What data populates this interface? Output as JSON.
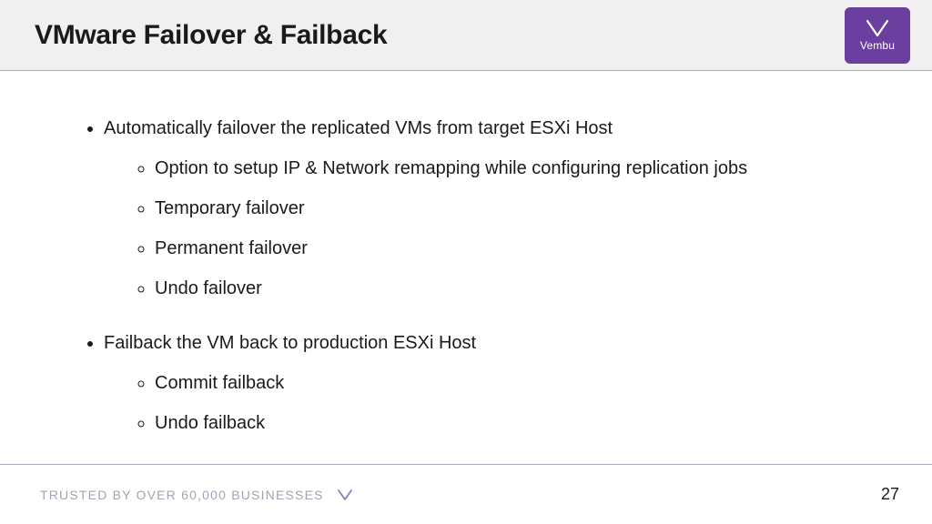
{
  "header": {
    "title": "VMware Failover & Failback",
    "brand_name": "Vembu"
  },
  "content": {
    "bullets": [
      {
        "text": "Automatically failover the replicated VMs from target ESXi Host",
        "sub": [
          "Option to setup IP & Network remapping while configuring replication jobs",
          "Temporary failover",
          "Permanent failover",
          "Undo failover"
        ]
      },
      {
        "text": "Failback the VM back to production ESXi Host",
        "sub": [
          "Commit failback",
          "Undo failback"
        ]
      }
    ]
  },
  "footer": {
    "tagline": "TRUSTED BY OVER 60,000 BUSINESSES",
    "page_number": "27"
  },
  "colors": {
    "brand": "#6b3fa0",
    "header_bg": "#f0f0f0",
    "divider": "#b0a8c0",
    "footer_text": "#a8a0b4"
  }
}
